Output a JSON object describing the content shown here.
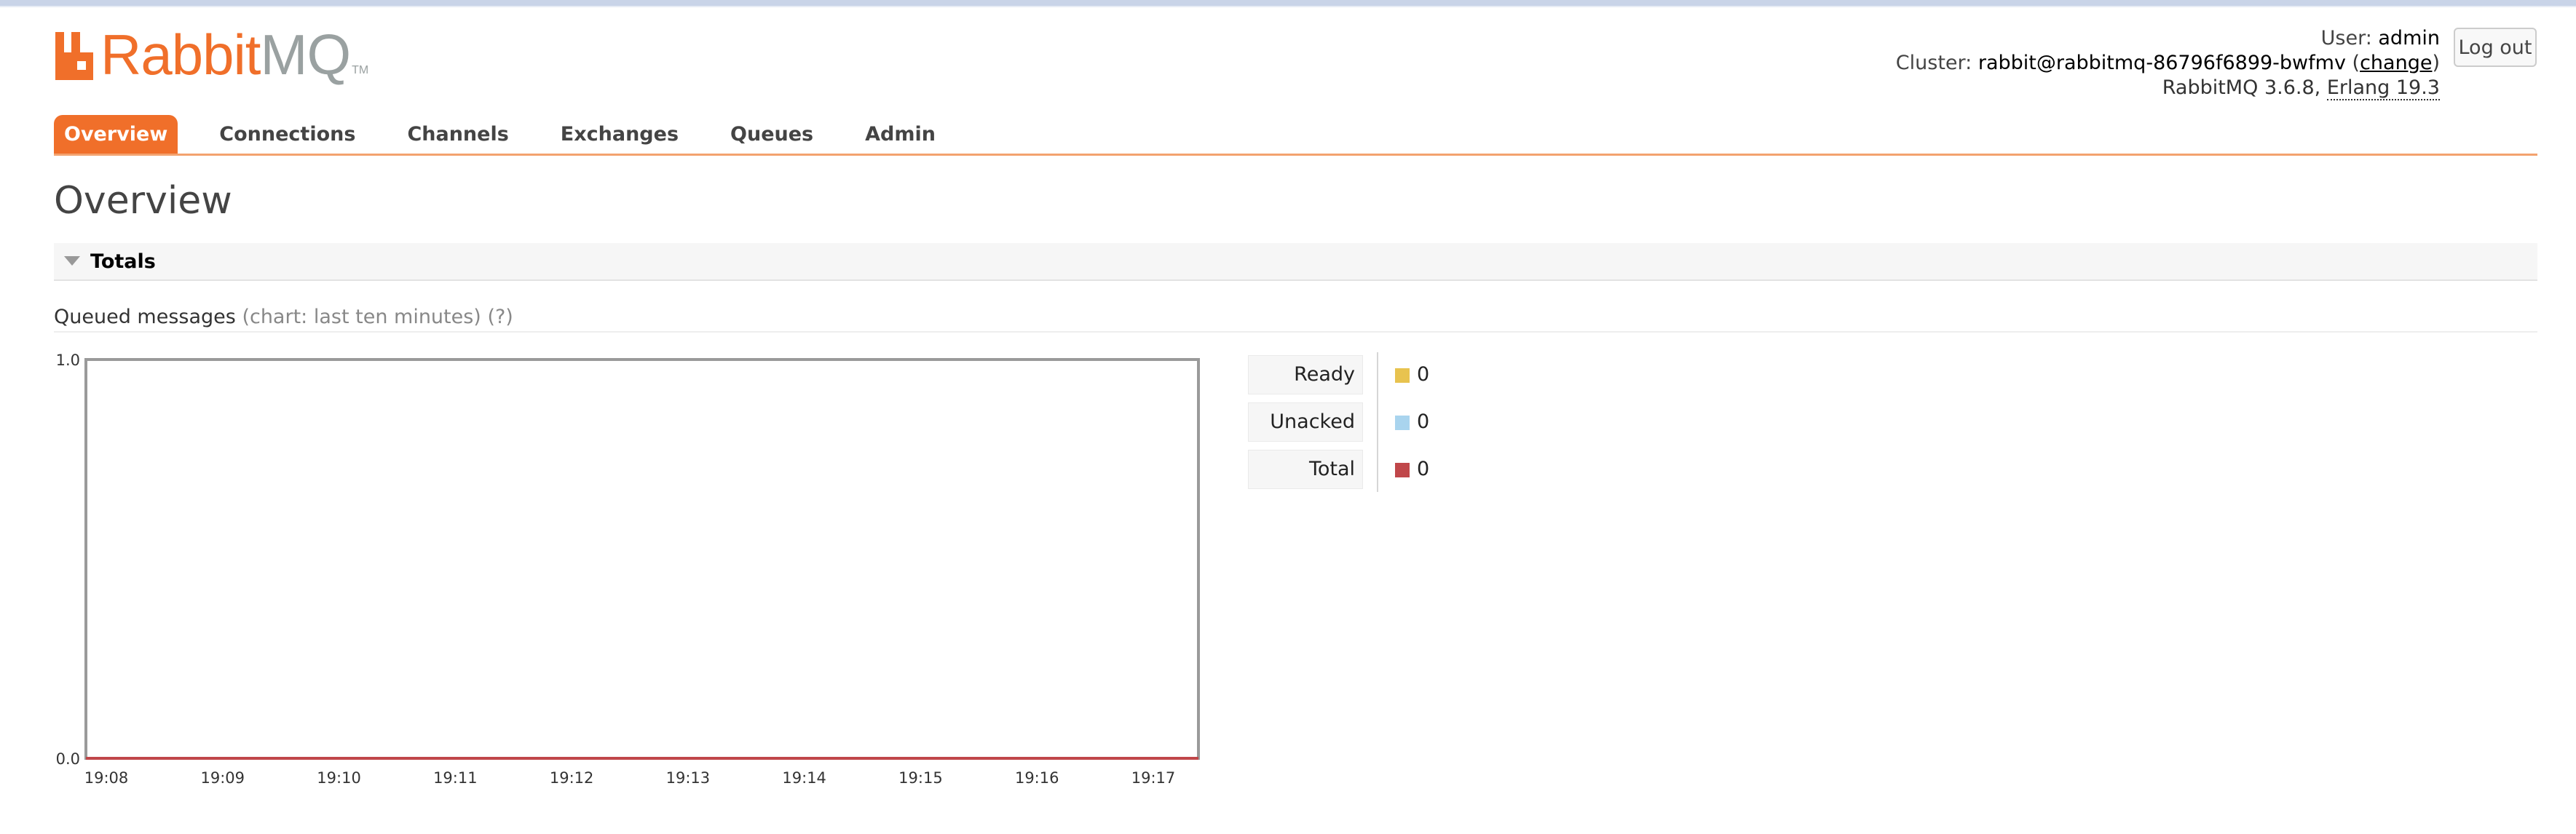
{
  "brand": {
    "name_primary": "Rabbit",
    "name_secondary": "MQ",
    "tm": "TM"
  },
  "header": {
    "user_label": "User:",
    "user_value": "admin",
    "cluster_label": "Cluster:",
    "cluster_value": "rabbit@rabbitmq-86796f6899-bwfmv",
    "cluster_change_open": "(",
    "cluster_change_link": "change",
    "cluster_change_close": ")",
    "version_text": "RabbitMQ 3.6.8,",
    "erlang_text": "Erlang 19.3",
    "logout_label": "Log out"
  },
  "tabs": [
    {
      "label": "Overview",
      "active": true
    },
    {
      "label": "Connections",
      "active": false
    },
    {
      "label": "Channels",
      "active": false
    },
    {
      "label": "Exchanges",
      "active": false
    },
    {
      "label": "Queues",
      "active": false
    },
    {
      "label": "Admin",
      "active": false
    }
  ],
  "page_title": "Overview",
  "section": {
    "title": "Totals"
  },
  "queued": {
    "label": "Queued messages",
    "chart_note": "(chart: last ten minutes)",
    "help": "(?)"
  },
  "legend": [
    {
      "label": "Ready",
      "value": "0",
      "color": "#e8c34f"
    },
    {
      "label": "Unacked",
      "value": "0",
      "color": "#a9d4ee"
    },
    {
      "label": "Total",
      "value": "0",
      "color": "#c0474a"
    }
  ],
  "colors": {
    "accent": "#f06f2a",
    "logo_grey": "#9aa1a1"
  },
  "chart_data": {
    "type": "line",
    "title": "",
    "xlabel": "",
    "ylabel": "",
    "x": [
      "19:08",
      "19:09",
      "19:10",
      "19:11",
      "19:12",
      "19:13",
      "19:14",
      "19:15",
      "19:16",
      "19:17"
    ],
    "y_ticks": [
      "0.0",
      "1.0"
    ],
    "ylim": [
      0,
      1
    ],
    "series": [
      {
        "name": "Ready",
        "values": [
          0,
          0,
          0,
          0,
          0,
          0,
          0,
          0,
          0,
          0
        ],
        "color": "#e8c34f"
      },
      {
        "name": "Unacked",
        "values": [
          0,
          0,
          0,
          0,
          0,
          0,
          0,
          0,
          0,
          0
        ],
        "color": "#a9d4ee"
      },
      {
        "name": "Total",
        "values": [
          0,
          0,
          0,
          0,
          0,
          0,
          0,
          0,
          0,
          0
        ],
        "color": "#c0474a"
      }
    ],
    "grid": false,
    "legend_position": "right"
  }
}
